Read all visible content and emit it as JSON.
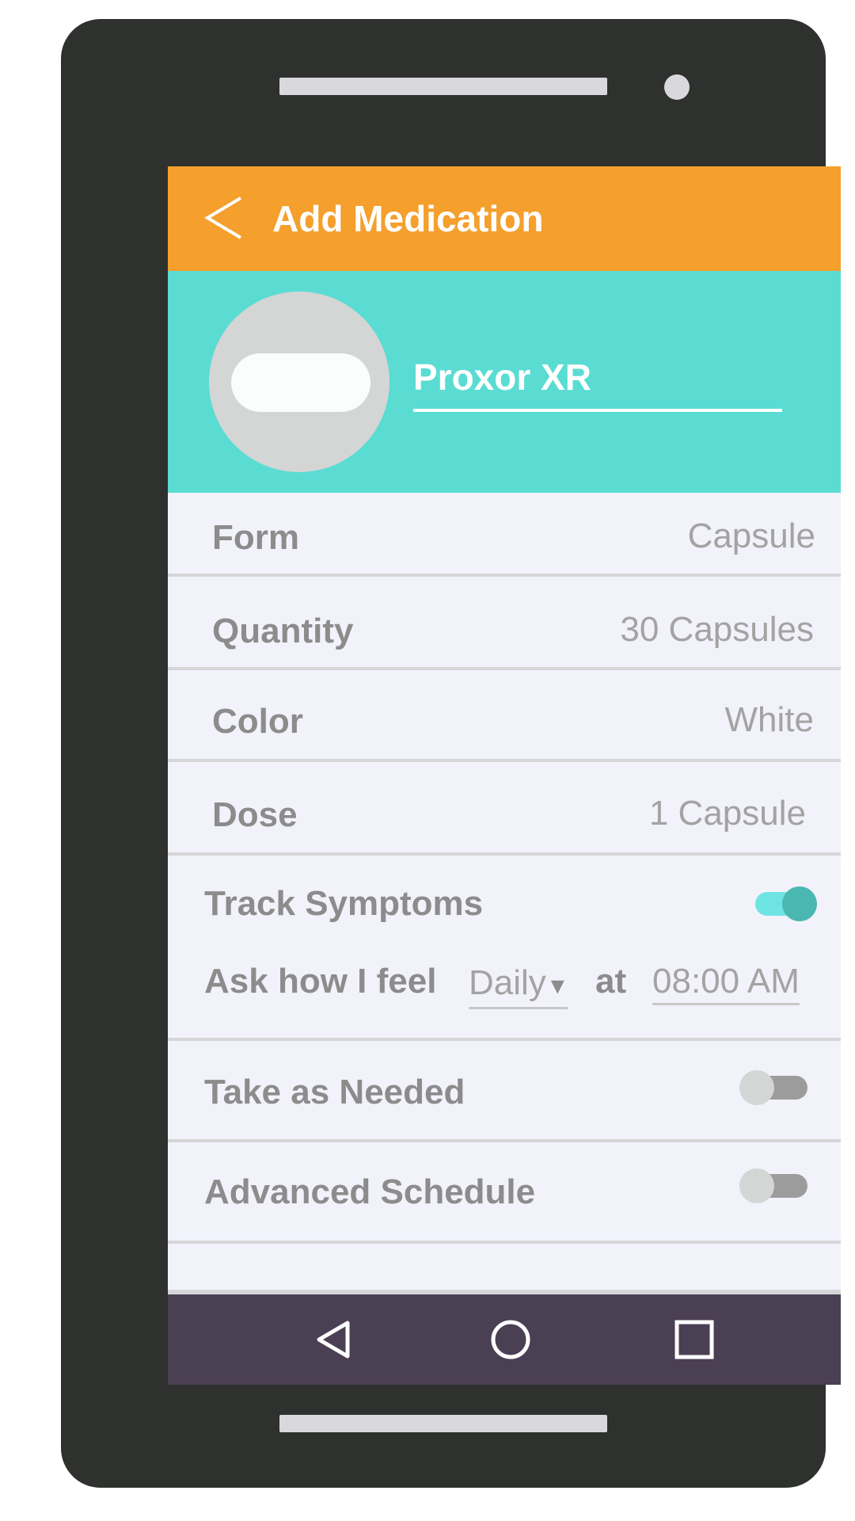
{
  "app_bar": {
    "title": "Add Medication",
    "back_icon": "chevron-left-icon"
  },
  "header": {
    "medication_name": "Proxor XR",
    "avatar_icon": "capsule-pill-icon"
  },
  "fields": [
    {
      "label": "Form",
      "value": "Capsule"
    },
    {
      "label": "Quantity",
      "value": "30 Capsules"
    },
    {
      "label": "Color",
      "value": "White"
    },
    {
      "label": "Dose",
      "value": "1 Capsule"
    }
  ],
  "track_symptoms": {
    "label": "Track Symptoms",
    "enabled": true,
    "ask_label": "Ask how I feel",
    "frequency": "Daily",
    "dropdown_arrow": "▾",
    "at_label": "at",
    "time": "08:00 AM"
  },
  "take_as_needed": {
    "label": "Take as Needed",
    "enabled": false
  },
  "advanced_schedule": {
    "label": "Advanced Schedule",
    "enabled": false
  },
  "nav_bar": {
    "back_icon": "triangle-back-icon",
    "home_icon": "circle-home-icon",
    "recents_icon": "square-recents-icon"
  },
  "colors": {
    "app_bar": "#f59f2d",
    "header": "#5adcd3",
    "nav_bar": "#4b3f54",
    "toggle_on": "#4bb7b1",
    "phone_body": "#2e312d"
  }
}
